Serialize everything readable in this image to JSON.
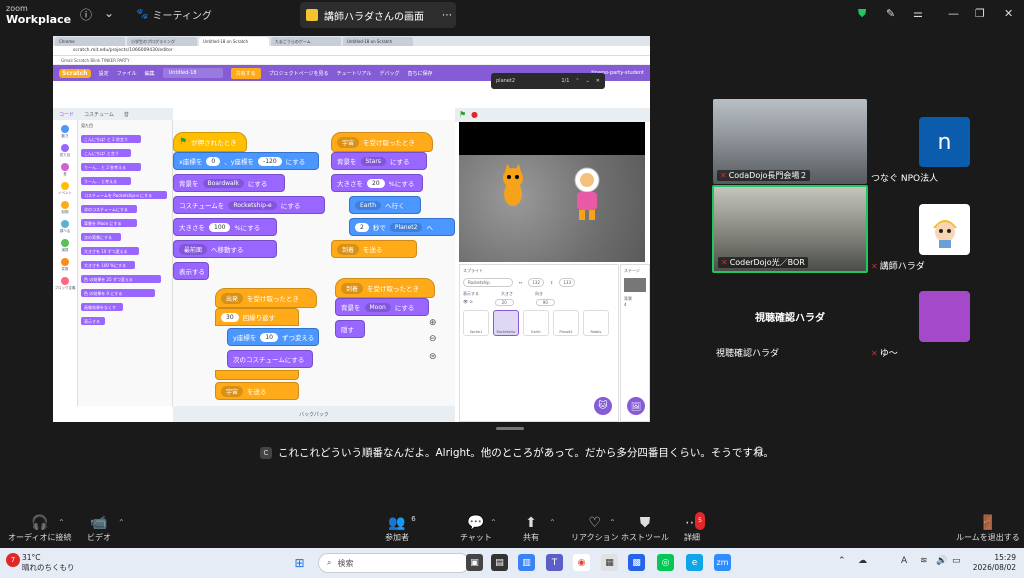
{
  "zoom": {
    "brand_top": "zoom",
    "brand_bottom": "Workplace",
    "meeting_label": "ミーティング",
    "share_tab_label": "講師ハラダさんの画面",
    "colors": {
      "bg": "#1a1a1a",
      "accent_green": "#22c55e",
      "alert_red": "#e02828"
    }
  },
  "scratch": {
    "chrome_tabs": [
      "Chrome",
      "小学生のプログラミング",
      "Untitled-18 on Scratch",
      "たまごうらのゲーム",
      "Untitled-18 on Scratch"
    ],
    "url": "scratch.mit.edu/projects/1066009430/editor",
    "bookmarks": "Gmail  Scratch  Blink  TINKER PARTY",
    "menu": {
      "logo": "Scratch",
      "settings": "設定",
      "file": "ファイル",
      "edit": "編集",
      "project_name": "Untitled-18",
      "share": "共有する",
      "project_page": "プロジェクトページを見る",
      "tutorial": "チュートリアル",
      "debug": "デバッグ",
      "save": "直ちに保存",
      "user": "tinwoo-party-student"
    },
    "find": {
      "query": "planet2",
      "count": "1/1"
    },
    "editor_tabs": [
      "コード",
      "コスチューム",
      "音"
    ],
    "categories": [
      "動き",
      "見た目",
      "音",
      "イベント",
      "制御",
      "調べる",
      "演算",
      "変数",
      "ブロック定義"
    ],
    "palette_title": "見た目",
    "palette_blocks": [
      "こんにちは! と 2 秒言う",
      "こんにちは! と言う",
      "うーん... と 2 秒考える",
      "うーん... と考える",
      "コスチュームを Rocketship-e にする",
      "次のコスチュームにする",
      "背景を Moon にする",
      "次の背景にする",
      "大きさを 10 ずつ変える",
      "大きさを 100 %にする",
      "色 の効果を 25 ずつ変える",
      "色 の効果を 0 にする",
      "画像効果をなくす",
      "表示する"
    ],
    "script1": {
      "hat": "が押されたとき",
      "goto_label_x": "x座標を",
      "goto_x": "0",
      "goto_label_y": "、y座標を",
      "goto_y": "-120",
      "goto_tail": "にする",
      "backdrop_label": "背景を",
      "backdrop": "Boardwalk",
      "backdrop_tail": "にする",
      "costume_label": "コスチュームを",
      "costume": "Rocketship-e",
      "costume_tail": "にする",
      "size_label": "大きさを",
      "size": "100",
      "size_tail": "%にする",
      "layer": "最前面",
      "layer_tail": "へ移動する",
      "show": "表示する"
    },
    "script2": {
      "hat_msg": "出発",
      "hat_tail": "を受け取ったとき",
      "repeat": "30",
      "repeat_tail": "回繰り返す",
      "change_label": "y座標を",
      "change": "10",
      "change_tail": "ずつ変える",
      "next_costume": "次のコスチュームにする",
      "broadcast_msg": "宇宙",
      "broadcast_tail": "を送る"
    },
    "script3": {
      "hat_msg": "宇宙",
      "hat_tail": "を受け取ったとき",
      "backdrop_label": "背景を",
      "backdrop": "Stars",
      "backdrop_tail": "にする",
      "size_label": "大きさを",
      "size": "20",
      "size_tail": "%にする",
      "goto_target": "Earth",
      "goto_tail": "へ行く",
      "glide_secs": "2",
      "glide_mid": "秒で",
      "glide_target": "Planet2",
      "glide_tail": "へ",
      "broadcast_msg": "到着",
      "broadcast_tail": "を送る"
    },
    "script4": {
      "hat_msg": "到着",
      "hat_tail": "を受け取ったとき",
      "backdrop_label": "背景を",
      "backdrop": "Moon",
      "backdrop_tail": "にする",
      "hide": "隠す"
    },
    "backpack": "バックパック",
    "sprite_pane": {
      "title": "スプライト",
      "name": "Rocketship",
      "x": "132",
      "y": "133",
      "show_label": "表示する",
      "size_label": "大きさ",
      "size": "20",
      "dir_label": "向き",
      "dir": "90",
      "sprites": [
        "Sprite1",
        "Rocketship",
        "Earth",
        "Planet2",
        "Robby"
      ]
    },
    "stage_pane": {
      "title": "ステージ",
      "backdrops_label": "背景",
      "backdrops_count": "4"
    }
  },
  "participants": {
    "tile1_name": "CodaDojo長門会場２",
    "tile2_name": "CoderDojo光／BOR",
    "n_tile_initial": "n",
    "n_tile_label": "つなぐ NPO法人",
    "harada_label": "講師ハラダ",
    "viewer_tile_title": "視聴確認ハラダ",
    "viewer_label": "視聴確認ハラダ",
    "yu_label": "ゆ〜"
  },
  "caption": {
    "badge": "C",
    "text": "これこれどういう順番なんだよ。Alright。他のところがあって。だから多分四番目くらい。そうですね。"
  },
  "toolbar": {
    "audio": "オーディオに接続",
    "video": "ビデオ",
    "participants": "参加者",
    "participants_count": "6",
    "chat": "チャット",
    "share": "共有",
    "reactions": "リアクション",
    "host_tools": "ホストツール",
    "more": "詳細",
    "more_badge": "5",
    "leave": "ルームを退出する"
  },
  "taskbar": {
    "weather_badge": "7",
    "temp": "31°C",
    "weather": "晴れのちくもり",
    "search": "検索",
    "time": "15:29",
    "date": "2026/08/02"
  }
}
